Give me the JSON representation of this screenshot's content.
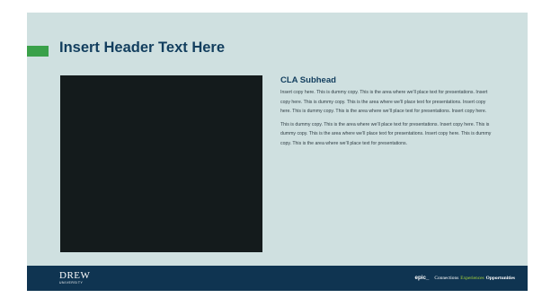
{
  "slide": {
    "header_title": "Insert Header Text Here",
    "subhead": "CLA Subhead",
    "paragraphs": [
      "Insert copy here. This is dummy copy. This is the area where we’ll place text for presentations. Insert copy here. This is dummy copy. This is the area where we’ll place text for presentations. Insert copy here. This is dummy copy. This is the area where we’ll place text for presentations. Insert copy here.",
      "This is dummy copy. This is the area where we’ll place text for presentations. Insert copy here. This is dummy copy. This is the area where we’ll place text for presentations. Insert copy here. This is dummy copy. This is the area where we’ll place text for presentations."
    ]
  },
  "footer": {
    "logo_word": "DREW",
    "logo_sub": "UNIVERSITY",
    "epic": "epic_",
    "tagline": {
      "connections": "Connections",
      "experiences": "Experiences",
      "opportunities": "Opportunities"
    }
  },
  "colors": {
    "slide_background": "#cfe0e0",
    "header_text": "#123e5e",
    "accent_bar": "#3aa14a",
    "image_placeholder": "#141b1c",
    "footer_background": "#0f3451",
    "tagline_highlight": "#a9d43a"
  }
}
